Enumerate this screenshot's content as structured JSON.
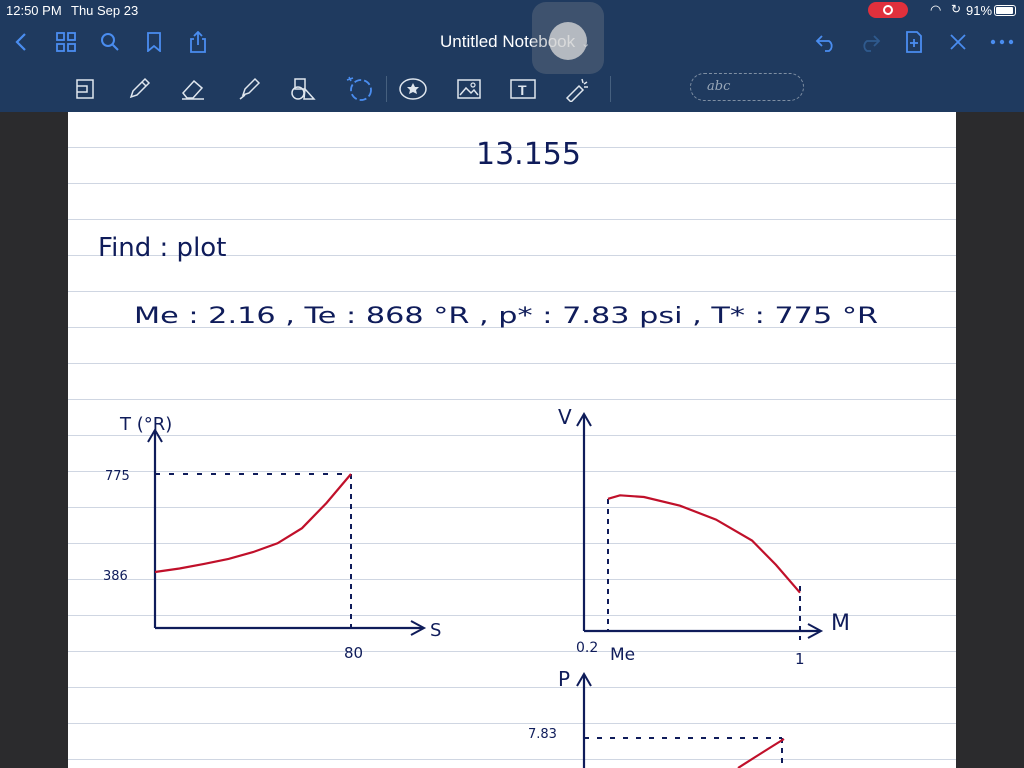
{
  "status_bar": {
    "time": "12:50 PM",
    "date": "Thu Sep 23",
    "battery": "91%"
  },
  "nav": {
    "title": "Untitled Notebook",
    "icons": [
      "back-icon",
      "grid-icon",
      "search-icon",
      "bookmark-icon",
      "share-icon",
      "undo-icon",
      "redo-icon",
      "add-page-icon",
      "close-icon",
      "more-icon"
    ]
  },
  "toolbar": {
    "tools": [
      "lasso-icon",
      "pen-icon",
      "eraser-icon",
      "highlighter-icon",
      "shapes-icon",
      "lasso-select-icon",
      "sticker-icon",
      "image-icon",
      "text-icon",
      "laser-pointer-icon"
    ],
    "abc_label": "abc"
  },
  "note": {
    "title": "13.155",
    "find_line": "Find : plot",
    "given_line": "Me : 2.16 , Te : 868 °R , p* : 7.83 psi , T* : 775 °R",
    "colors": {
      "ink": "#0f1c5a",
      "curve": "#c0102a"
    }
  },
  "chart_data": [
    {
      "type": "line",
      "title": "",
      "xlabel": "S",
      "ylabel": "T (°R)",
      "x_ticks": [
        "80"
      ],
      "y_ticks": [
        "775",
        "386"
      ],
      "series": [
        {
          "x": [
            0,
            10,
            20,
            30,
            40,
            50,
            60,
            70,
            80
          ],
          "y": [
            386,
            400,
            418,
            438,
            465,
            500,
            560,
            660,
            775
          ]
        }
      ]
    },
    {
      "type": "line",
      "title": "",
      "xlabel": "M",
      "ylabel": "V",
      "x_ticks": [
        "0.2",
        "Me",
        "1"
      ],
      "series": [
        {
          "x": [
            0.2,
            0.25,
            0.35,
            0.5,
            0.65,
            0.8,
            0.9,
            1.0
          ],
          "y": [
            0.76,
            0.78,
            0.77,
            0.72,
            0.64,
            0.52,
            0.38,
            0.22
          ]
        }
      ]
    },
    {
      "type": "line",
      "title": "",
      "ylabel": "P",
      "y_ticks": [
        "7.83"
      ],
      "series": []
    }
  ]
}
